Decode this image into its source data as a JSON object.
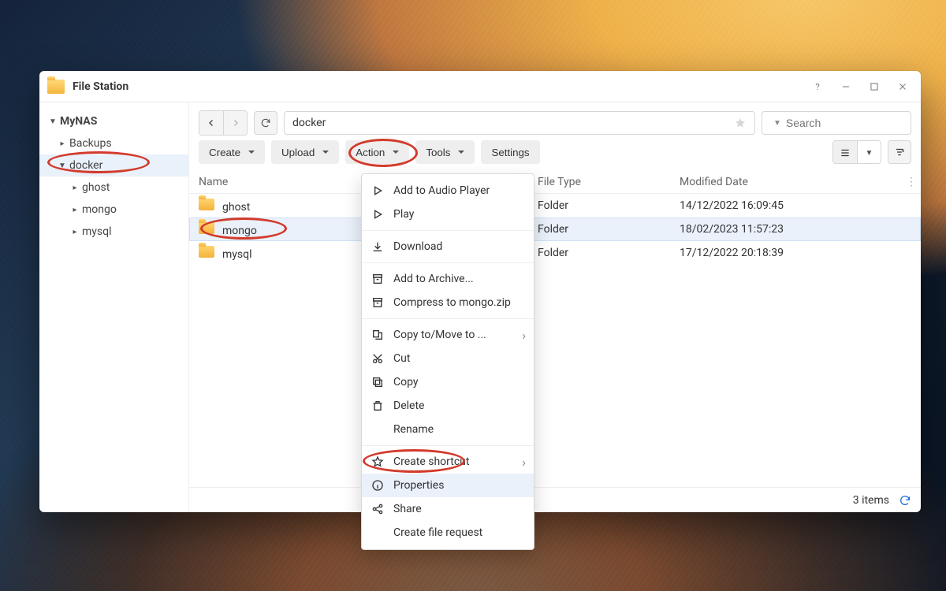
{
  "window": {
    "title": "File Station"
  },
  "titlebar_icons": {
    "help": "?",
    "min": "minimize",
    "max": "maximize",
    "close": "close"
  },
  "sidebar": {
    "root": "MyNAS",
    "items": [
      {
        "label": "Backups",
        "level": 1,
        "expanded": false
      },
      {
        "label": "docker",
        "level": 1,
        "expanded": true,
        "selected": true
      },
      {
        "label": "ghost",
        "level": 2,
        "expanded": false
      },
      {
        "label": "mongo",
        "level": 2,
        "expanded": false
      },
      {
        "label": "mysql",
        "level": 2,
        "expanded": false
      }
    ]
  },
  "nav": {
    "back": "back",
    "forward": "forward",
    "reload": "reload",
    "breadcrumb": "docker",
    "star": "star"
  },
  "search": {
    "placeholder": "Search"
  },
  "toolbar": {
    "create": "Create",
    "upload": "Upload",
    "action": "Action",
    "tools": "Tools",
    "settings": "Settings",
    "view_list": "list-view",
    "view_mode_caret": "caret",
    "sort": "sort"
  },
  "grid": {
    "columns": {
      "name": "Name",
      "type": "File Type",
      "date": "Modified Date"
    },
    "rows": [
      {
        "name": "ghost",
        "type": "Folder",
        "date": "14/12/2022 16:09:45",
        "selected": false
      },
      {
        "name": "mongo",
        "type": "Folder",
        "date": "18/02/2023 11:57:23",
        "selected": true
      },
      {
        "name": "mysql",
        "type": "Folder",
        "date": "17/12/2022 20:18:39",
        "selected": false
      }
    ]
  },
  "status": {
    "items_text": "3 items"
  },
  "ctx": {
    "items": [
      {
        "label": "Add to Audio Player",
        "icon": "play-outline"
      },
      {
        "label": "Play",
        "icon": "play-outline"
      },
      {
        "sep": true
      },
      {
        "label": "Download",
        "icon": "download"
      },
      {
        "sep": true
      },
      {
        "label": "Add to Archive...",
        "icon": "archive"
      },
      {
        "label": "Compress to mongo.zip",
        "icon": "archive"
      },
      {
        "sep": true
      },
      {
        "label": "Copy to/Move to ...",
        "icon": "copy-move",
        "submenu": true
      },
      {
        "label": "Cut",
        "icon": "cut"
      },
      {
        "label": "Copy",
        "icon": "copy"
      },
      {
        "label": "Delete",
        "icon": "trash"
      },
      {
        "label": "Rename",
        "icon": ""
      },
      {
        "sep": true
      },
      {
        "label": "Create shortcut",
        "icon": "star-outline",
        "submenu": true
      },
      {
        "label": "Properties",
        "icon": "info",
        "hovered": true
      },
      {
        "label": "Share",
        "icon": "share"
      },
      {
        "label": "Create file request",
        "icon": ""
      }
    ]
  }
}
